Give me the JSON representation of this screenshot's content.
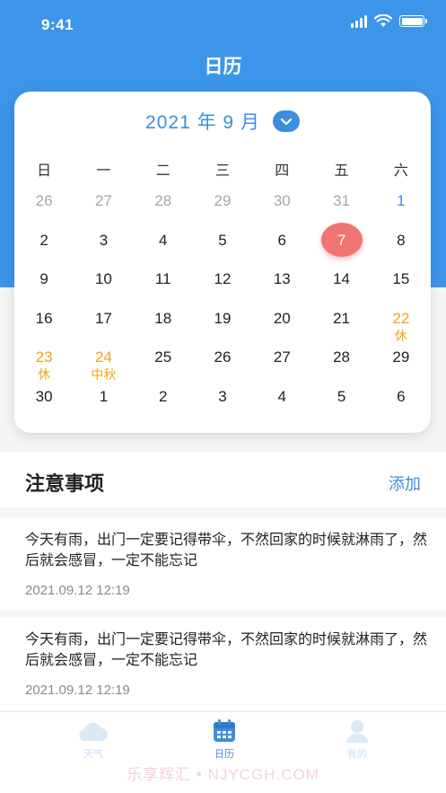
{
  "status": {
    "time": "9:41"
  },
  "header": {
    "title": "日历"
  },
  "calendar": {
    "month_label": "2021 年 9 月",
    "weekdays": [
      "日",
      "一",
      "二",
      "三",
      "四",
      "五",
      "六"
    ],
    "days": [
      {
        "n": "26",
        "t": "other"
      },
      {
        "n": "27",
        "t": "other"
      },
      {
        "n": "28",
        "t": "other"
      },
      {
        "n": "29",
        "t": "other"
      },
      {
        "n": "30",
        "t": "other"
      },
      {
        "n": "31",
        "t": "other"
      },
      {
        "n": "1",
        "t": "blue"
      },
      {
        "n": "2"
      },
      {
        "n": "3"
      },
      {
        "n": "4"
      },
      {
        "n": "5"
      },
      {
        "n": "6"
      },
      {
        "n": "7",
        "t": "today"
      },
      {
        "n": "8"
      },
      {
        "n": "9"
      },
      {
        "n": "10"
      },
      {
        "n": "11"
      },
      {
        "n": "12"
      },
      {
        "n": "13"
      },
      {
        "n": "14"
      },
      {
        "n": "15"
      },
      {
        "n": "16"
      },
      {
        "n": "17"
      },
      {
        "n": "18"
      },
      {
        "n": "19"
      },
      {
        "n": "20"
      },
      {
        "n": "21"
      },
      {
        "n": "22",
        "t": "holiday",
        "sub": "休"
      },
      {
        "n": "23",
        "t": "holiday",
        "sub": "休"
      },
      {
        "n": "24",
        "t": "holiday",
        "sub": "中秋"
      },
      {
        "n": "25"
      },
      {
        "n": "26"
      },
      {
        "n": "27"
      },
      {
        "n": "28"
      },
      {
        "n": "29"
      },
      {
        "n": "30"
      },
      {
        "n": "1"
      },
      {
        "n": "2"
      },
      {
        "n": "3"
      },
      {
        "n": "4"
      },
      {
        "n": "5"
      },
      {
        "n": "6"
      }
    ]
  },
  "notes": {
    "title": "注意事项",
    "add_label": "添加",
    "items": [
      {
        "text": "今天有雨，出门一定要记得带伞，不然回家的时候就淋雨了，然后就会感冒，一定不能忘记",
        "time": "2021.09.12 12:19"
      },
      {
        "text": "今天有雨，出门一定要记得带伞，不然回家的时候就淋雨了，然后就会感冒，一定不能忘记",
        "time": "2021.09.12 12:19"
      }
    ]
  },
  "tabs": [
    {
      "label": "天气",
      "icon": "cloud-icon"
    },
    {
      "label": "日历",
      "icon": "calendar-icon"
    },
    {
      "label": "我的",
      "icon": "user-icon"
    }
  ],
  "watermark": "乐享辉汇 • NJYCGH.COM",
  "colors": {
    "primary": "#3d95e9",
    "today": "#f07572",
    "holiday": "#f0a414"
  }
}
